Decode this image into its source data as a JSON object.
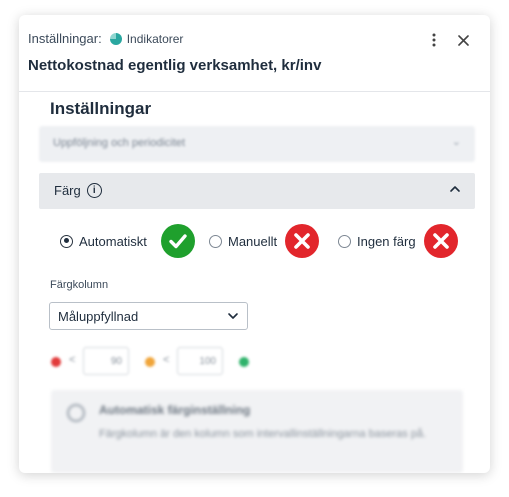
{
  "header": {
    "breadcrumb_label": "Inställningar:",
    "tag_label": "Indikatorer",
    "title": "Nettokostnad egentlig verksamhet, kr/inv"
  },
  "settings": {
    "section_title": "Inställningar",
    "collapsed_section_label": "Uppföljning och periodicitet",
    "color_section_label": "Färg",
    "radio_options": [
      {
        "label": "Automatiskt",
        "checked": true,
        "badge": "check"
      },
      {
        "label": "Manuellt",
        "checked": false,
        "badge": "cross"
      },
      {
        "label": "Ingen färg",
        "checked": false,
        "badge": "cross"
      }
    ],
    "color_column_label": "Färgkolumn",
    "color_column_value": "Måluppfyllnad",
    "thresholds": {
      "lt_symbol": "<",
      "value_1": "90",
      "value_2": "100",
      "colors": [
        "#e23b3b",
        "#f0a53a",
        "#2fb36b"
      ]
    },
    "info_box": {
      "heading": "Automatisk färginställning",
      "text": "Färgkolumn är den kolumn som intervallinställningarna baseras på."
    }
  },
  "colors": {
    "check_badge": "#1fa02d",
    "cross_badge": "#e2262c",
    "accent_tag": "#2aa7a0"
  }
}
